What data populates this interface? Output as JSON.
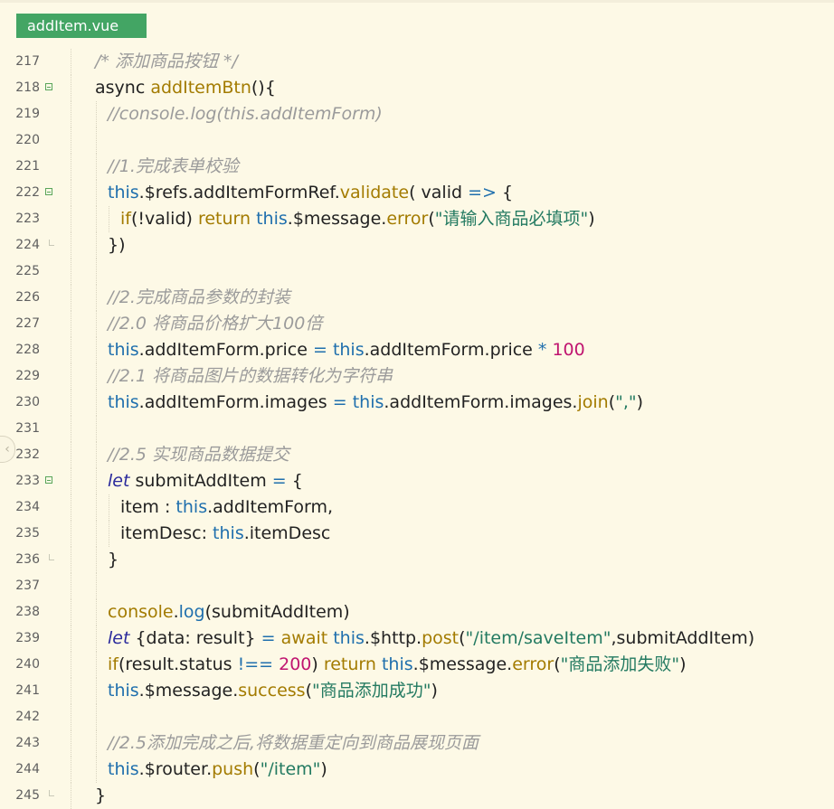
{
  "tab": {
    "label": "addItem.vue"
  },
  "lines": [
    {
      "num": "217",
      "indent": 0,
      "segs": [
        [
          "cm",
          "/* 添加商品按钮 */"
        ]
      ]
    },
    {
      "num": "218",
      "indent": 0,
      "fold": "open",
      "segs": [
        [
          "tx",
          "async "
        ],
        [
          "fn",
          "addItemBtn"
        ],
        [
          "tx",
          "(){"
        ]
      ]
    },
    {
      "num": "219",
      "indent": 1,
      "segs": [
        [
          "cm",
          "//console.log(this.addItemForm)"
        ]
      ]
    },
    {
      "num": "220",
      "indent": 1,
      "segs": []
    },
    {
      "num": "221",
      "indent": 1,
      "segs": [
        [
          "cm",
          "//1.完成表单校验"
        ]
      ]
    },
    {
      "num": "222",
      "indent": 1,
      "fold": "open",
      "segs": [
        [
          "kw",
          "this"
        ],
        [
          "tx",
          ".$refs.addItemFormRef."
        ],
        [
          "fn",
          "validate"
        ],
        [
          "tx",
          "( valid "
        ],
        [
          "op",
          "=>"
        ],
        [
          "tx",
          " {"
        ]
      ]
    },
    {
      "num": "223",
      "indent": 2,
      "segs": [
        [
          "fn",
          "if"
        ],
        [
          "tx",
          "(!valid) "
        ],
        [
          "fn",
          "return "
        ],
        [
          "kw",
          "this"
        ],
        [
          "tx",
          ".$message."
        ],
        [
          "fn",
          "error"
        ],
        [
          "tx",
          "("
        ],
        [
          "st",
          "\"请输入商品必填项\""
        ],
        [
          "tx",
          ")"
        ]
      ]
    },
    {
      "num": "224",
      "indent": 1,
      "fold": "end",
      "segs": [
        [
          "tx",
          "})"
        ]
      ]
    },
    {
      "num": "225",
      "indent": 1,
      "segs": []
    },
    {
      "num": "226",
      "indent": 1,
      "segs": [
        [
          "cm",
          "//2.完成商品参数的封装"
        ]
      ]
    },
    {
      "num": "227",
      "indent": 1,
      "segs": [
        [
          "cm",
          "//2.0 将商品价格扩大100倍"
        ]
      ]
    },
    {
      "num": "228",
      "indent": 1,
      "segs": [
        [
          "kw",
          "this"
        ],
        [
          "tx",
          ".addItemForm.price "
        ],
        [
          "op",
          "="
        ],
        [
          "tx",
          " "
        ],
        [
          "kw",
          "this"
        ],
        [
          "tx",
          ".addItemForm.price "
        ],
        [
          "op",
          "*"
        ],
        [
          "tx",
          " "
        ],
        [
          "nm",
          "100"
        ]
      ]
    },
    {
      "num": "229",
      "indent": 1,
      "segs": [
        [
          "cm",
          "//2.1 将商品图片的数据转化为字符串"
        ]
      ]
    },
    {
      "num": "230",
      "indent": 1,
      "segs": [
        [
          "kw",
          "this"
        ],
        [
          "tx",
          ".addItemForm.images "
        ],
        [
          "op",
          "="
        ],
        [
          "tx",
          " "
        ],
        [
          "kw",
          "this"
        ],
        [
          "tx",
          ".addItemForm.images."
        ],
        [
          "fn",
          "join"
        ],
        [
          "tx",
          "("
        ],
        [
          "st",
          "\",\""
        ],
        [
          "tx",
          ")"
        ]
      ]
    },
    {
      "num": "231",
      "indent": 1,
      "segs": []
    },
    {
      "num": "232",
      "indent": 1,
      "segs": [
        [
          "cm",
          "//2.5 实现商品数据提交"
        ]
      ]
    },
    {
      "num": "233",
      "indent": 1,
      "fold": "open",
      "segs": [
        [
          "lt",
          "let"
        ],
        [
          "tx",
          " submitAddItem "
        ],
        [
          "op",
          "="
        ],
        [
          "tx",
          " {"
        ]
      ]
    },
    {
      "num": "234",
      "indent": 2,
      "segs": [
        [
          "tx",
          "item : "
        ],
        [
          "kw",
          "this"
        ],
        [
          "tx",
          ".addItemForm,"
        ]
      ]
    },
    {
      "num": "235",
      "indent": 2,
      "segs": [
        [
          "tx",
          "itemDesc: "
        ],
        [
          "kw",
          "this"
        ],
        [
          "tx",
          ".itemDesc"
        ]
      ]
    },
    {
      "num": "236",
      "indent": 1,
      "fold": "end",
      "segs": [
        [
          "tx",
          "}"
        ]
      ]
    },
    {
      "num": "237",
      "indent": 1,
      "segs": []
    },
    {
      "num": "238",
      "indent": 1,
      "segs": [
        [
          "fn",
          "console"
        ],
        [
          "tx",
          "."
        ],
        [
          "kw",
          "log"
        ],
        [
          "tx",
          "(submitAddItem)"
        ]
      ]
    },
    {
      "num": "239",
      "indent": 1,
      "segs": [
        [
          "lt",
          "let"
        ],
        [
          "tx",
          " {data: result} "
        ],
        [
          "op",
          "="
        ],
        [
          "tx",
          " "
        ],
        [
          "fn",
          "await "
        ],
        [
          "kw",
          "this"
        ],
        [
          "tx",
          ".$http."
        ],
        [
          "fn",
          "post"
        ],
        [
          "tx",
          "("
        ],
        [
          "st",
          "\"/item/saveItem\""
        ],
        [
          "tx",
          ",submitAddItem)"
        ]
      ]
    },
    {
      "num": "240",
      "indent": 1,
      "segs": [
        [
          "fn",
          "if"
        ],
        [
          "tx",
          "(result.status "
        ],
        [
          "op",
          "!=="
        ],
        [
          "tx",
          " "
        ],
        [
          "nm",
          "200"
        ],
        [
          "tx",
          ") "
        ],
        [
          "fn",
          "return "
        ],
        [
          "kw",
          "this"
        ],
        [
          "tx",
          ".$message."
        ],
        [
          "fn",
          "error"
        ],
        [
          "tx",
          "("
        ],
        [
          "st",
          "\"商品添加失败\""
        ],
        [
          "tx",
          ")"
        ]
      ]
    },
    {
      "num": "241",
      "indent": 1,
      "segs": [
        [
          "kw",
          "this"
        ],
        [
          "tx",
          ".$message."
        ],
        [
          "fn",
          "success"
        ],
        [
          "tx",
          "("
        ],
        [
          "st",
          "\"商品添加成功\""
        ],
        [
          "tx",
          ")"
        ]
      ]
    },
    {
      "num": "242",
      "indent": 1,
      "segs": []
    },
    {
      "num": "243",
      "indent": 1,
      "segs": [
        [
          "cm",
          "//2.5添加完成之后,将数据重定向到商品展现页面"
        ]
      ]
    },
    {
      "num": "244",
      "indent": 1,
      "segs": [
        [
          "kw",
          "this"
        ],
        [
          "tx",
          ".$router."
        ],
        [
          "fn",
          "push"
        ],
        [
          "tx",
          "("
        ],
        [
          "st",
          "\"/item\""
        ],
        [
          "tx",
          ")"
        ]
      ]
    },
    {
      "num": "245",
      "indent": 0,
      "fold": "end",
      "segs": [
        [
          "tx",
          "}"
        ]
      ]
    }
  ],
  "colors": {
    "background": "#fdf9e6",
    "tab": "#43a564",
    "keyword": "#1f6fad",
    "function": "#a37b00",
    "string": "#237a61",
    "number": "#c01570",
    "comment": "#9b9b9b"
  },
  "icons": {
    "sidebar_handle": "chevron-left-icon",
    "fold_open": "minus-box-icon",
    "fold_end": "fold-end-icon"
  }
}
